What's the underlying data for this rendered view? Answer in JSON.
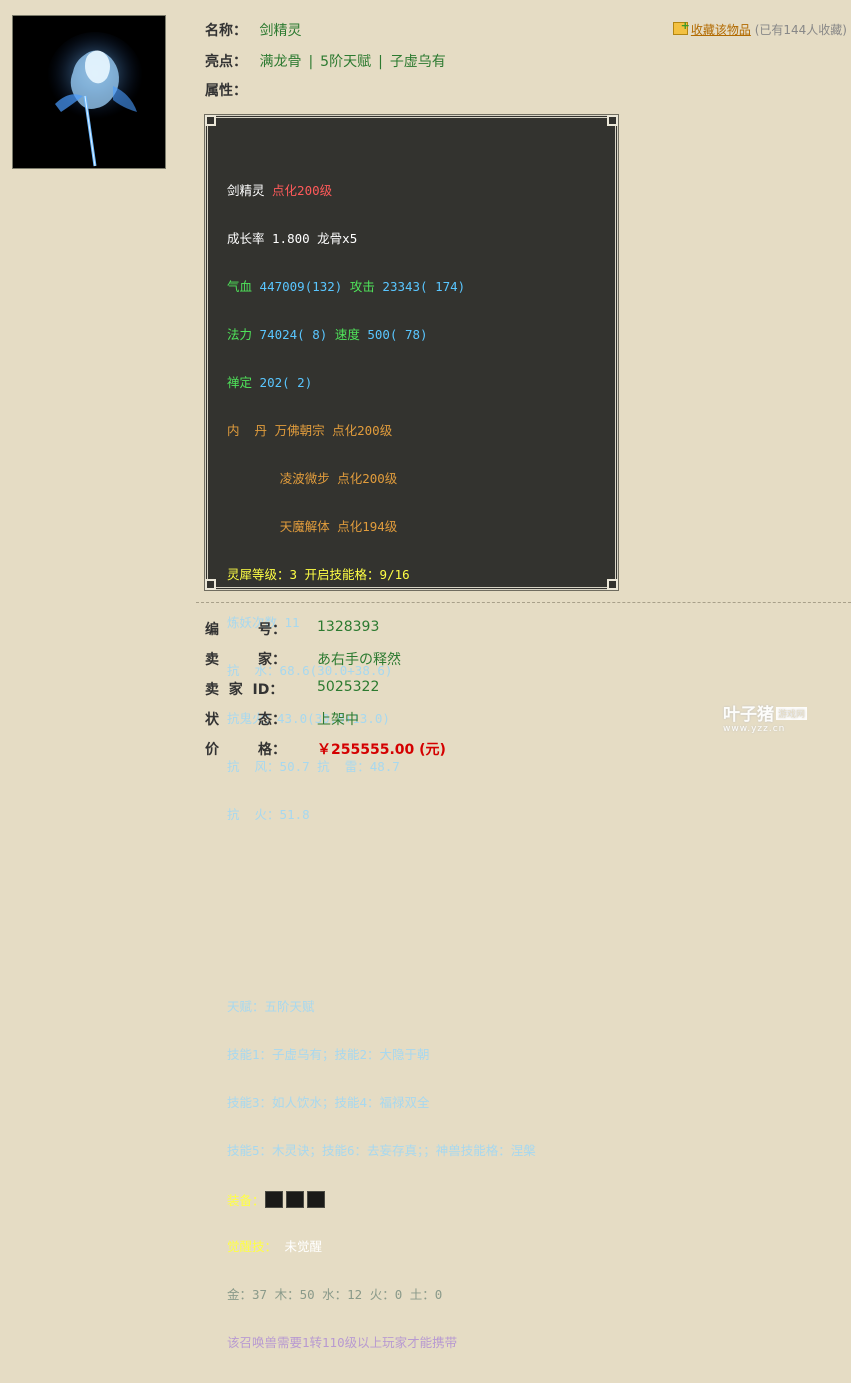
{
  "item": {
    "name_label": "名称：",
    "name": "剑精灵",
    "highlight_label": "亮点：",
    "highlights": [
      "满龙骨",
      "5阶天赋",
      "子虚乌有"
    ],
    "highlight_sep": "|",
    "attr_label": "属性：",
    "favorite_link": "收藏该物品",
    "favorite_count": "(已有144人收藏)"
  },
  "tooltip": {
    "name": "剑精灵",
    "name_tag": "点化200级",
    "growth": "成长率 1.800 龙骨x5",
    "hp_label": "气血",
    "hp_value": "447009(132)",
    "atk_label": "攻击",
    "atk_value": "23343( 174)",
    "mp_label": "法力",
    "mp_value": "74024( 8)",
    "spd_label": "速度",
    "spd_value": "500( 78)",
    "zen_label": "禅定",
    "zen_value": "202( 2)",
    "neidan_label": "内  丹",
    "neidan_1": "万佛朝宗 点化200级",
    "neidan_2": "凌波微步 点化200级",
    "neidan_3": "天魔解体 点化194级",
    "spirit": "灵犀等级：3 开启技能格：9/16",
    "refine": "炼妖次数 11",
    "resist_water": "抗  水：68.6(30.0+38.6)",
    "resist_ghostfire": "抗鬼火：43.0(30.0+13.0)",
    "resist_wind_thunder": "抗  风：50.7 抗  雷：48.7",
    "resist_fire": "抗  火：51.8",
    "talent": "天赋：五阶天赋",
    "skills_1": "技能1：子虚乌有；技能2：大隐于朝",
    "skills_2": "技能3：如人饮水；技能4：福禄双全",
    "skills_3": "技能5：木灵诀；技能6：去妄存真；；神兽技能格：涅槃",
    "equip_label": "装备：",
    "awaken_label": "觉醒技：",
    "awaken_value": "未觉醒",
    "elements": "金：37 木：50 水：12 火：0 土：0",
    "requirement": "该召唤兽需要1转110级以上玩家才能携带"
  },
  "details": [
    {
      "label": "编        号：",
      "value": "1328393"
    },
    {
      "label": "卖        家：",
      "value": "あ右手の释然"
    },
    {
      "label": "卖  家  ID：",
      "value": "5025322"
    },
    {
      "label": "状        态：",
      "value": "上架中"
    },
    {
      "label": "价        格：",
      "value": "￥255555.00 (元)"
    }
  ],
  "watermark": {
    "main": "叶子猪",
    "tag": "游戏网",
    "sub": "www.yzz.cn"
  },
  "colors": {
    "background": "#e5dcc4",
    "value_green": "#2c7a30",
    "price_red": "#d40000",
    "tooltip_bg": "#33332f"
  }
}
